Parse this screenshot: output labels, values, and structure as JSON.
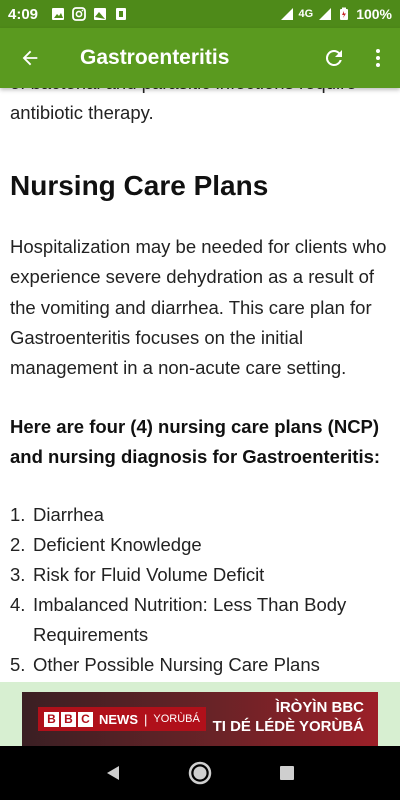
{
  "status_bar": {
    "time": "4:09",
    "network": "4G",
    "battery": "100%"
  },
  "app_bar": {
    "title": "Gastroenteritis",
    "back_icon": "arrow-left-icon",
    "refresh_icon": "refresh-icon",
    "menu_icon": "more-vert-icon",
    "background": "#5a9a1f"
  },
  "content": {
    "partial_line_1": "of bacterial and parasitic infections require",
    "partial_line_2": "antibiotic therapy.",
    "heading": "Nursing Care Plans",
    "paragraph": "Hospitalization may be needed for clients who experience severe dehydration as a result of the vomiting and diarrhea. This care plan for Gastroenteritis focuses on the initial management in a non-acute care setting.",
    "bold_paragraph": "Here are four (4) nursing care plans (NCP) and nursing diagnosis for Gastroenteritis:",
    "list": [
      {
        "num": "1.",
        "text": "Diarrhea"
      },
      {
        "num": "2.",
        "text": "Deficient Knowledge"
      },
      {
        "num": "3.",
        "text": "Risk for Fluid Volume Deficit"
      },
      {
        "num": "4.",
        "text": "Imbalanced Nutrition: Less Than Body Requirements"
      },
      {
        "num": "5.",
        "text": "Other Possible Nursing Care Plans"
      }
    ]
  },
  "ad": {
    "bbc_b1": "B",
    "bbc_b2": "B",
    "bbc_c": "C",
    "news": "NEWS",
    "separator": "|",
    "language": "YORÙBÁ",
    "headline_1": "ÌRÒYÌN BBC",
    "headline_2": "TI DÉ LÉDÈ YORÙBÁ"
  },
  "nav_bar": {
    "back": "nav-back-icon",
    "home": "nav-home-icon",
    "recents": "nav-recents-icon"
  }
}
